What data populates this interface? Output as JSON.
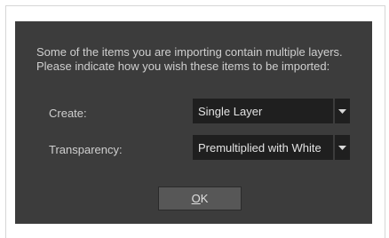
{
  "dialog": {
    "message_line1": "Some of the items you are importing contain multiple layers.",
    "message_line2": "Please indicate how you wish these items to be imported:",
    "create": {
      "label": "Create:",
      "selected": "Single Layer"
    },
    "transparency": {
      "label": "Transparency:",
      "selected": "Premultiplied with White"
    },
    "ok_button": {
      "mnemonic": "O",
      "rest": "K"
    }
  },
  "colors": {
    "dialog_background": "#3c3c3c",
    "field_background": "#1f1f1f",
    "button_background": "#575757",
    "text": "#d4d4d4"
  },
  "icons": {
    "dropdown": "chevron-down-icon"
  }
}
